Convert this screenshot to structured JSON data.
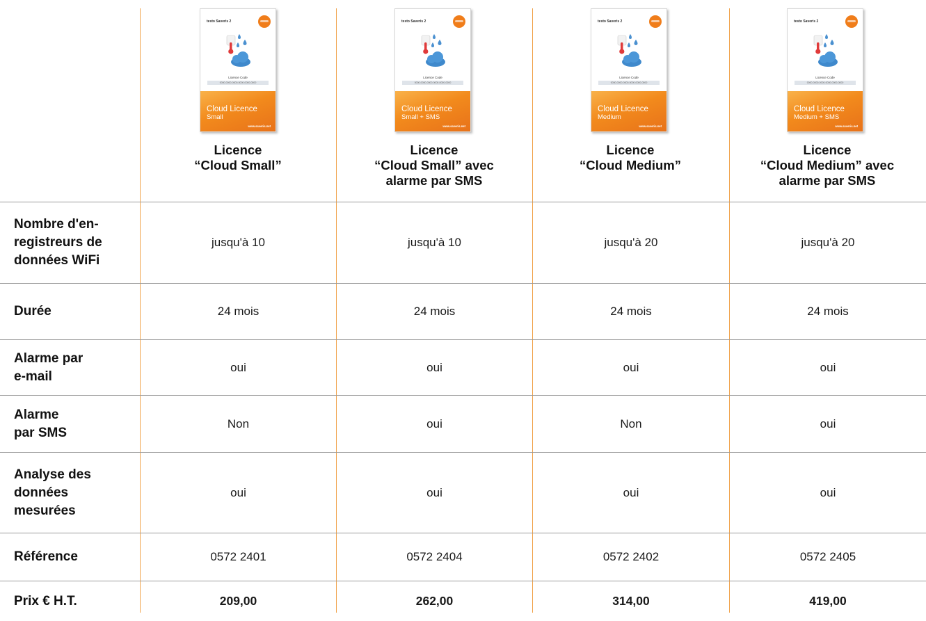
{
  "products": [
    {
      "title_line1": "Licence",
      "title_line2": "“Cloud Small”",
      "title_line3": "",
      "box": {
        "brand": "testo Saveris 2",
        "code_label": "Licence Code",
        "code": "0000-0000-0000-0000-0000-0000",
        "band_line1": "Cloud Licence",
        "band_line2": "Small",
        "url": "www.saveris.net"
      }
    },
    {
      "title_line1": "Licence",
      "title_line2": "“Cloud Small” avec",
      "title_line3": "alarme par SMS",
      "box": {
        "brand": "testo Saveris 2",
        "code_label": "Licence Code",
        "code": "0000-0000-0000-0000-0000-0000",
        "band_line1": "Cloud Licence",
        "band_line2": "Small + SMS",
        "url": "www.saveris.net"
      }
    },
    {
      "title_line1": "Licence",
      "title_line2": "“Cloud Medium”",
      "title_line3": "",
      "box": {
        "brand": "testo Saveris 2",
        "code_label": "Licence Code",
        "code": "0000-0000-0000-0000-0000-0000",
        "band_line1": "Cloud Licence",
        "band_line2": "Medium",
        "url": "www.saveris.net"
      }
    },
    {
      "title_line1": "Licence",
      "title_line2": "“Cloud Medium” avec",
      "title_line3": "alarme par SMS",
      "box": {
        "brand": "testo Saveris 2",
        "code_label": "Licence Code",
        "code": "0000-0000-0000-0000-0000-0000",
        "band_line1": "Cloud Licence",
        "band_line2": "Medium + SMS",
        "url": "www.saveris.net"
      }
    }
  ],
  "rows": [
    {
      "label_lines": [
        "Nombre d'en-",
        "registreurs de",
        "données WiFi"
      ],
      "values": [
        "jusqu'à 10",
        "jusqu'à 10",
        "jusqu'à 20",
        "jusqu'à 20"
      ]
    },
    {
      "label_lines": [
        "Durée"
      ],
      "values": [
        "24 mois",
        "24 mois",
        "24 mois",
        "24 mois"
      ]
    },
    {
      "label_lines": [
        "Alarme par",
        "e-mail"
      ],
      "values": [
        "oui",
        "oui",
        "oui",
        "oui"
      ]
    },
    {
      "label_lines": [
        "Alarme",
        "par SMS"
      ],
      "values": [
        "Non",
        "oui",
        "Non",
        "oui"
      ]
    },
    {
      "label_lines": [
        "Analyse des",
        "données",
        "mesurées"
      ],
      "values": [
        "oui",
        "oui",
        "oui",
        "oui"
      ]
    },
    {
      "label_lines": [
        "Référence"
      ],
      "values": [
        "0572 2401",
        "0572 2404",
        "0572 2402",
        "0572 2405"
      ]
    },
    {
      "label_lines": [
        "Prix € H.T."
      ],
      "values": [
        "209,00",
        "262,00",
        "314,00",
        "419,00"
      ]
    }
  ],
  "colors": {
    "accent": "#f0a24a",
    "band": "#f28a1c",
    "divider": "#9a9a9a"
  }
}
